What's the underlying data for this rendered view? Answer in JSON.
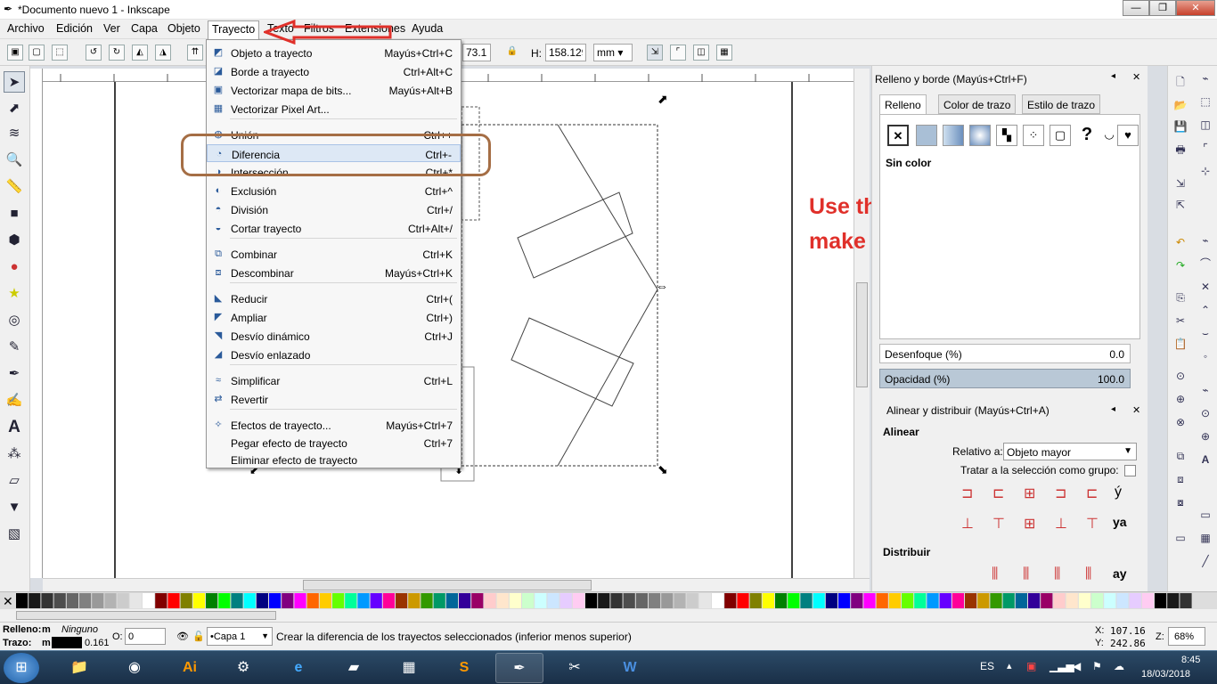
{
  "window": {
    "title": "*Documento nuevo 1 - Inkscape",
    "min": "—",
    "max": "❐",
    "close": "✕"
  },
  "menubar": [
    "Archivo",
    "Edición",
    "Ver",
    "Capa",
    "Objeto",
    "Trayecto",
    "Texto",
    "Filtros",
    "Extensiones",
    "Ayuda"
  ],
  "controls": {
    "w_value": "73.173",
    "h_label": "H:",
    "h_value": "158.129",
    "unit": "mm"
  },
  "dropdown": [
    {
      "label": "Objeto a trayecto",
      "shortcut": "Mayús+Ctrl+C",
      "icon": "object-to-path-icon"
    },
    {
      "label": "Borde a trayecto",
      "shortcut": "Ctrl+Alt+C",
      "icon": "stroke-to-path-icon"
    },
    {
      "label": "Vectorizar mapa de bits...",
      "shortcut": "Mayús+Alt+B",
      "icon": "trace-bitmap-icon"
    },
    {
      "label": "Vectorizar Pixel Art...",
      "shortcut": "",
      "icon": "trace-pixel-art-icon"
    },
    {
      "label": "Unión",
      "shortcut": "Ctrl++",
      "icon": "union-icon"
    },
    {
      "label": "Diferencia",
      "shortcut": "Ctrl+-",
      "icon": "difference-icon"
    },
    {
      "label": "Intersección",
      "shortcut": "Ctrl+*",
      "icon": "intersection-icon"
    },
    {
      "label": "Exclusión",
      "shortcut": "Ctrl+^",
      "icon": "exclusion-icon"
    },
    {
      "label": "División",
      "shortcut": "Ctrl+/",
      "icon": "division-icon"
    },
    {
      "label": "Cortar trayecto",
      "shortcut": "Ctrl+Alt+/",
      "icon": "cut-path-icon"
    },
    {
      "label": "Combinar",
      "shortcut": "Ctrl+K",
      "icon": "combine-icon"
    },
    {
      "label": "Descombinar",
      "shortcut": "Mayús+Ctrl+K",
      "icon": "break-apart-icon"
    },
    {
      "label": "Reducir",
      "shortcut": "Ctrl+(",
      "icon": "inset-icon"
    },
    {
      "label": "Ampliar",
      "shortcut": "Ctrl+)",
      "icon": "outset-icon"
    },
    {
      "label": "Desvío dinámico",
      "shortcut": "Ctrl+J",
      "icon": "dynamic-offset-icon"
    },
    {
      "label": "Desvío enlazado",
      "shortcut": "",
      "icon": "linked-offset-icon"
    },
    {
      "label": "Simplificar",
      "shortcut": "Ctrl+L",
      "icon": "simplify-icon"
    },
    {
      "label": "Revertir",
      "shortcut": "",
      "icon": "reverse-icon"
    },
    {
      "label": "Efectos de trayecto...",
      "shortcut": "Mayús+Ctrl+7",
      "icon": "path-effects-icon"
    },
    {
      "label": "Pegar efecto de trayecto",
      "shortcut": "Ctrl+7",
      "icon": ""
    },
    {
      "label": "Eliminar efecto de trayecto",
      "shortcut": "",
      "icon": ""
    }
  ],
  "annotation": {
    "note": "Use the \"difference\" tool to make the slots"
  },
  "fill_stroke": {
    "title": "Relleno y borde (Mayús+Ctrl+F)",
    "tabs": [
      "Relleno",
      "Color de trazo",
      "Estilo de trazo"
    ],
    "no_paint": "Sin color",
    "blur_label": "Desenfoque (%)",
    "blur_value": "0.0",
    "opacity_label": "Opacidad (%)",
    "opacity_value": "100.0"
  },
  "align": {
    "title": "Alinear y distribuir (Mayús+Ctrl+A)",
    "align_heading": "Alinear",
    "relative_label": "Relativo a:",
    "relative_value": "Objeto mayor",
    "group_label": "Tratar a la selección como grupo:",
    "distribute_heading": "Distribuir"
  },
  "status": {
    "fill_label": "Relleno:",
    "fill_value": "m",
    "fill_paint": "Ninguno",
    "stroke_label": "Trazo:",
    "stroke_value": "m",
    "stroke_width": "0.161",
    "o_label": "O:",
    "o_value": "0",
    "layer": "•Capa 1",
    "message": "Crear la diferencia de los trayectos seleccionados (inferior menos superior)",
    "x_label": "X:",
    "x_value": "107.16",
    "y_label": "Y:",
    "y_value": "242.86",
    "z_label": "Z:",
    "zoom": "68%"
  },
  "taskbar": {
    "lang": "ES",
    "time": "8:45",
    "date": "18/03/2018"
  },
  "colors": {
    "annotation_red": "#e0302a",
    "oval_brown": "#a56e45",
    "menu_hover": "#dde8f5"
  }
}
